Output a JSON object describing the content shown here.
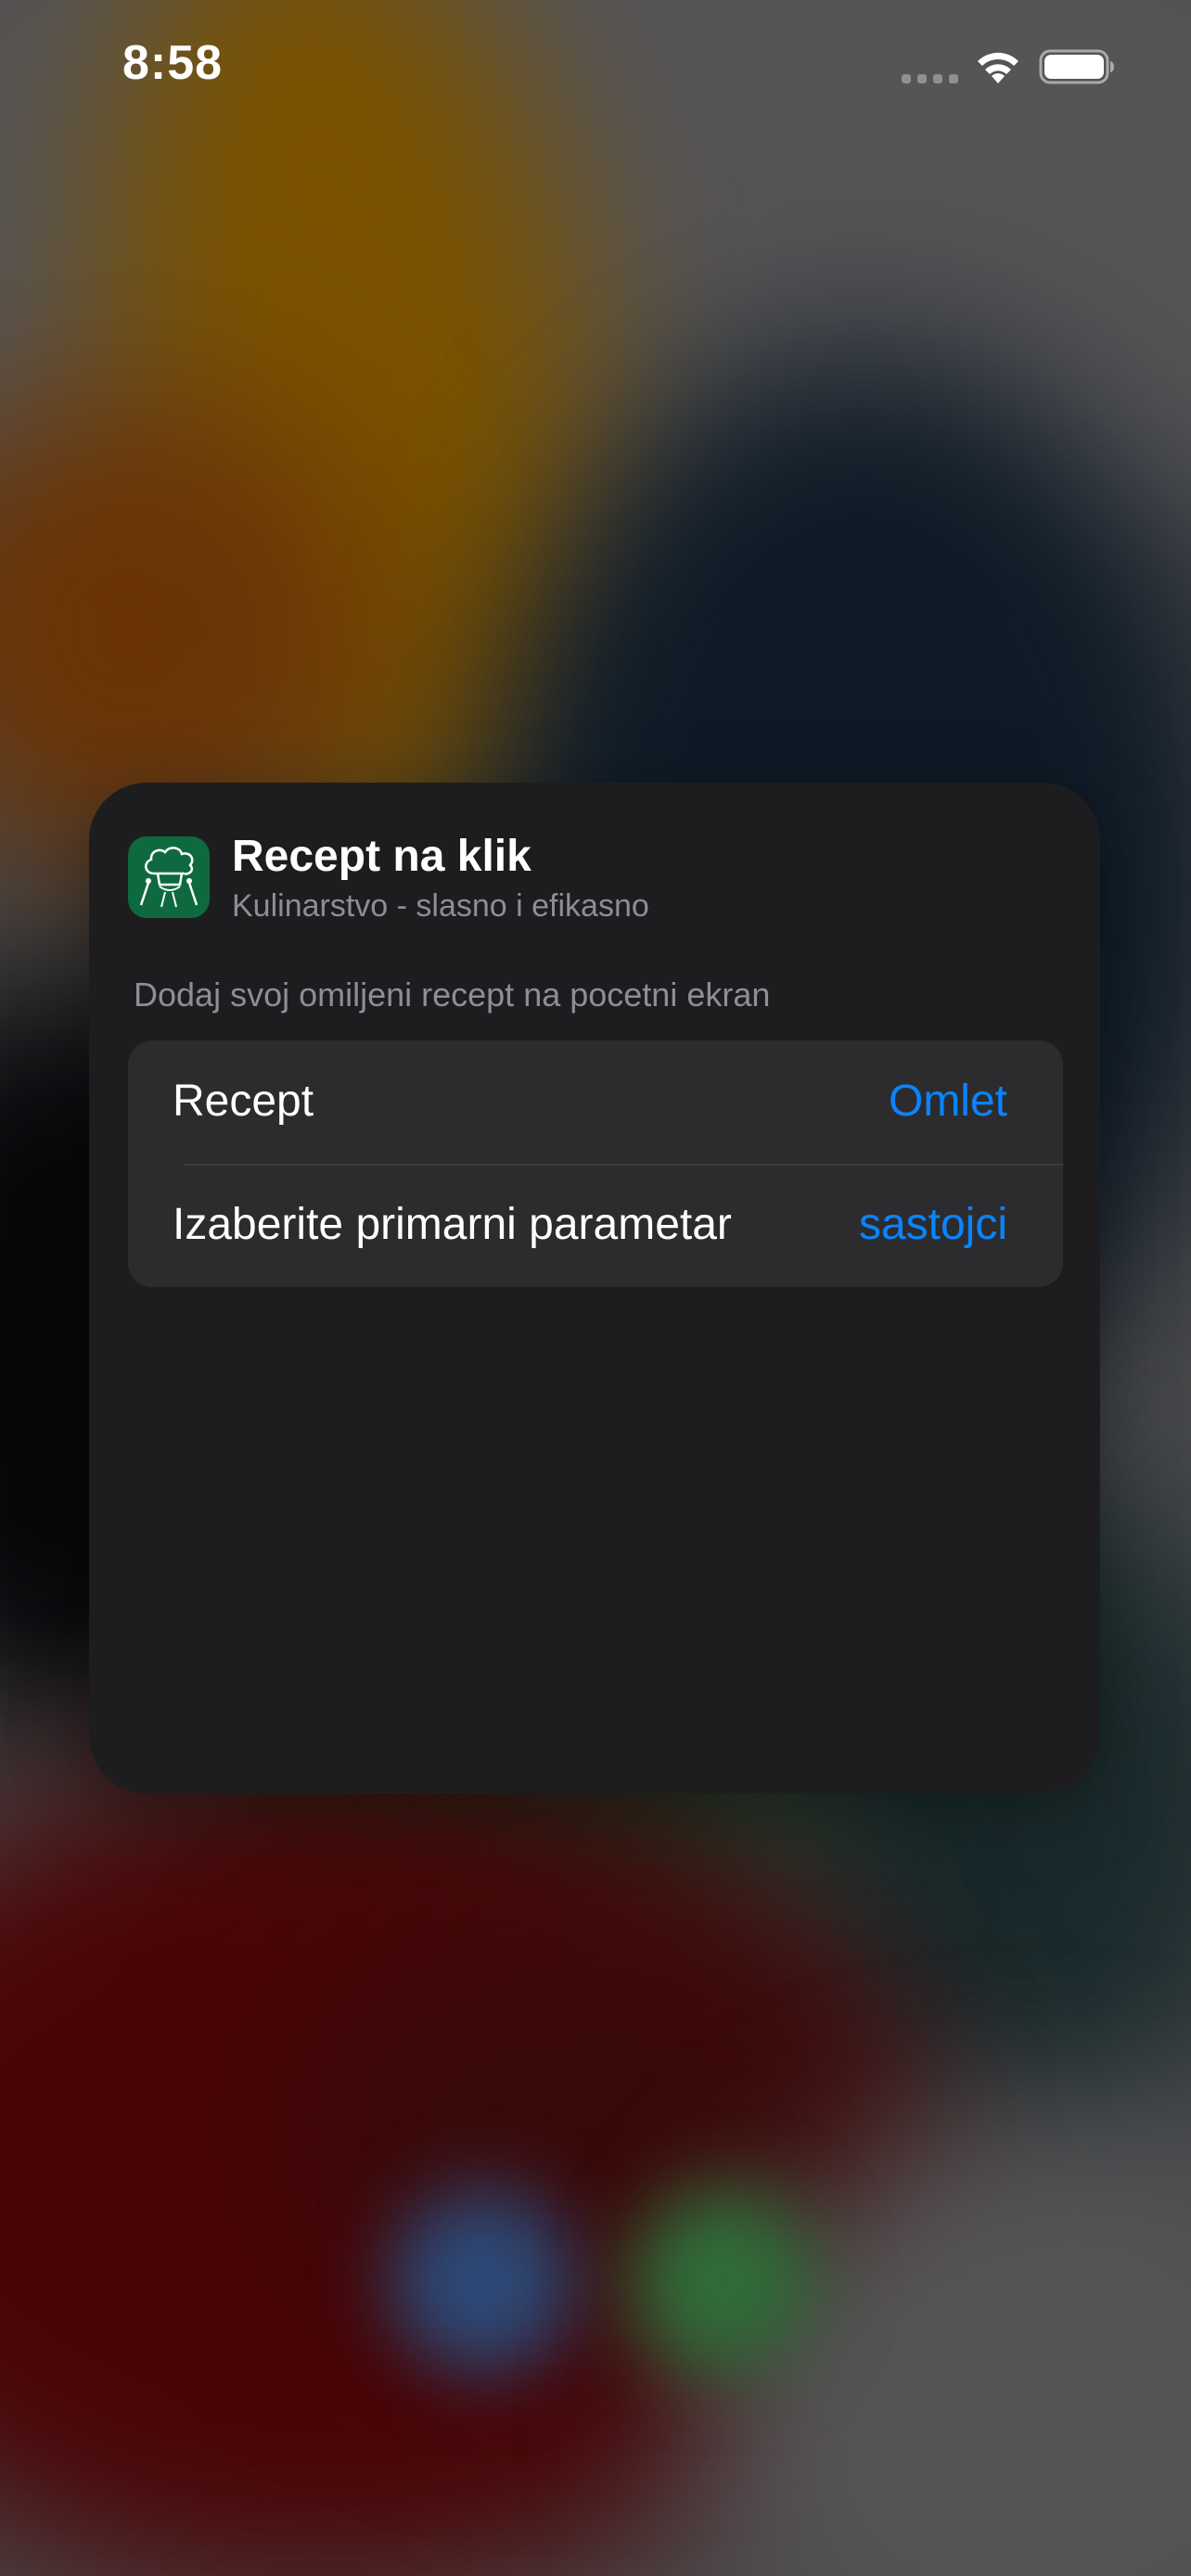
{
  "status_bar": {
    "time": "8:58",
    "signal_icon": "signal-dots-icon",
    "wifi_icon": "wifi-icon",
    "battery_icon": "battery-icon"
  },
  "widget_config": {
    "app_icon": "chef-hat-icon",
    "app_name": "Recept na klik",
    "app_subtitle": "Kulinarstvo - slasno i efikasno",
    "description": "Dodaj svoj omiljeni recept na pocetni ekran",
    "parameters": [
      {
        "label": "Recept",
        "value": "Omlet"
      },
      {
        "label": "Izaberite primarni parametar",
        "value": "sastojci"
      }
    ],
    "accent_color": "#0a84ff",
    "panel_color": "#1d1d1f",
    "app_icon_color": "#0e6a3e"
  }
}
